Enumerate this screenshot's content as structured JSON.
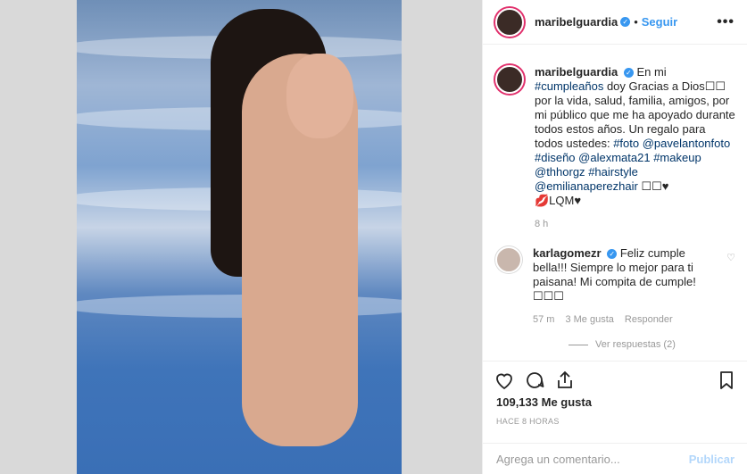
{
  "post": {
    "username": "maribelguardia",
    "follow_label": "Seguir",
    "more_label": "•••"
  },
  "caption": {
    "username": "maribelguardia",
    "text_1": "En mi",
    "tag_1": "#cumpleaños",
    "text_2": "doy Gracias a Dios☐☐ por la vida, salud, familia, amigos, por mi público que me ha apoyado durante todos estos años. Un regalo para todos ustedes:",
    "tag_2": "#foto",
    "tag_3": "@pavelantonfoto",
    "tag_4": "#diseño",
    "tag_5": "@alexmata21",
    "tag_6": "#makeup",
    "tag_7": "@thhorgz",
    "tag_8": "#hairstyle",
    "tag_9": "@emilianaperezhair",
    "text_3": "☐☐♥",
    "text_4": "💋LQM♥",
    "time": "8 h"
  },
  "comment": {
    "username": "karlagomezr",
    "text": "Feliz cumple bella!!! Siempre lo mejor para ti paisana! Mi compita de cumple! ☐☐☐",
    "time": "57 m",
    "likes": "3 Me gusta",
    "reply_label": "Responder",
    "view_replies": "Ver respuestas (2)"
  },
  "stats": {
    "likes_count": "109,133",
    "likes_label": "Me gusta",
    "posted": "HACE 8 HORAS"
  },
  "add_comment": {
    "placeholder": "Agrega un comentario...",
    "publish_label": "Publicar"
  }
}
